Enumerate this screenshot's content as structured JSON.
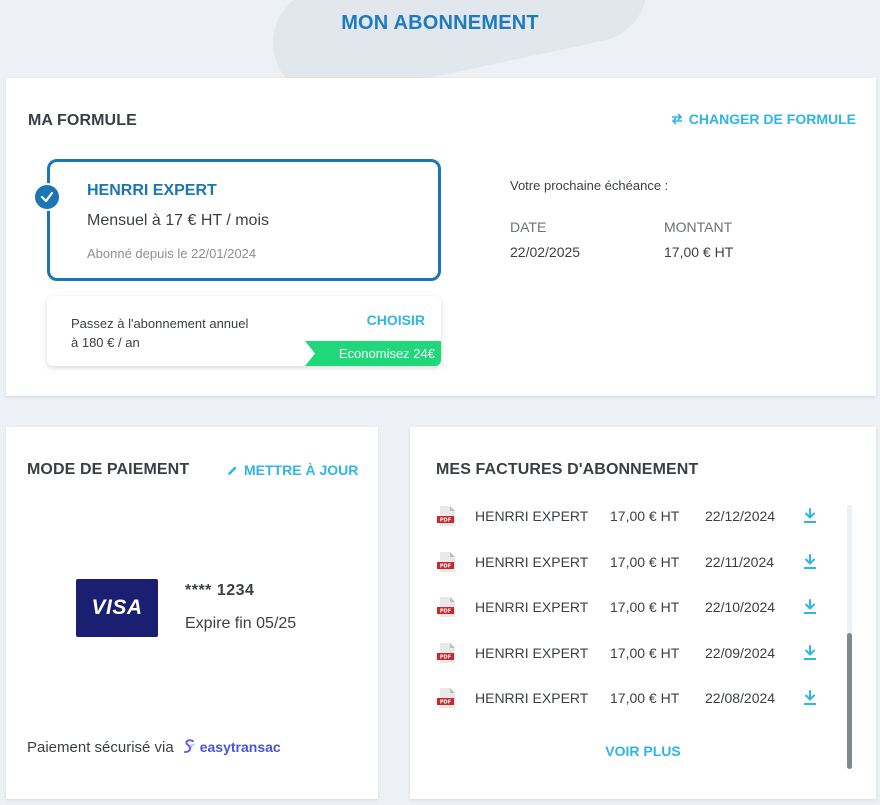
{
  "page": {
    "title": "MON ABONNEMENT"
  },
  "formule": {
    "title": "MA FORMULE",
    "change_label": "CHANGER DE FORMULE",
    "plan": {
      "name": "HENRRI EXPERT",
      "price": "Mensuel à 17 € HT / mois",
      "since": "Abonné depuis le 22/01/2024"
    },
    "upsell": {
      "line1": "Passez à l'abonnement annuel",
      "line2": "à 180 € / an",
      "choose_label": "CHOISIR",
      "ribbon": "Economisez 24€"
    },
    "echeance": {
      "title": "Votre prochaine échéance :",
      "date_label": "DATE",
      "date_value": "22/02/2025",
      "montant_label": "MONTANT",
      "montant_value": "17,00 € HT"
    }
  },
  "paiement": {
    "title": "MODE DE PAIEMENT",
    "update_label": "METTRE À JOUR",
    "card_brand": "VISA",
    "card_number": "**** 1234",
    "card_expiry": "Expire fin 05/25",
    "secure_text": "Paiement sécurisé via",
    "provider": "easytransac"
  },
  "factures": {
    "title": "MES FACTURES D'ABONNEMENT",
    "rows": [
      {
        "name": "HENRRI EXPERT",
        "amount": "17,00 € HT",
        "date": "22/12/2024"
      },
      {
        "name": "HENRRI EXPERT",
        "amount": "17,00 € HT",
        "date": "22/11/2024"
      },
      {
        "name": "HENRRI EXPERT",
        "amount": "17,00 € HT",
        "date": "22/10/2024"
      },
      {
        "name": "HENRRI EXPERT",
        "amount": "17,00 € HT",
        "date": "22/09/2024"
      },
      {
        "name": "HENRRI EXPERT",
        "amount": "17,00 € HT",
        "date": "22/08/2024"
      }
    ],
    "more_label": "VOIR PLUS"
  },
  "colors": {
    "primary": "#1c76b6",
    "link": "#2fb6e4",
    "success": "#1fd87a",
    "visa": "#1a1f71",
    "pdf": "#d0262a"
  },
  "icons": {
    "change": "swap-arrows-icon",
    "update": "pencil-icon",
    "selected": "check-circle-icon",
    "invoice": "pdf-file-icon",
    "download": "download-icon",
    "provider": "easytransac-logo"
  }
}
